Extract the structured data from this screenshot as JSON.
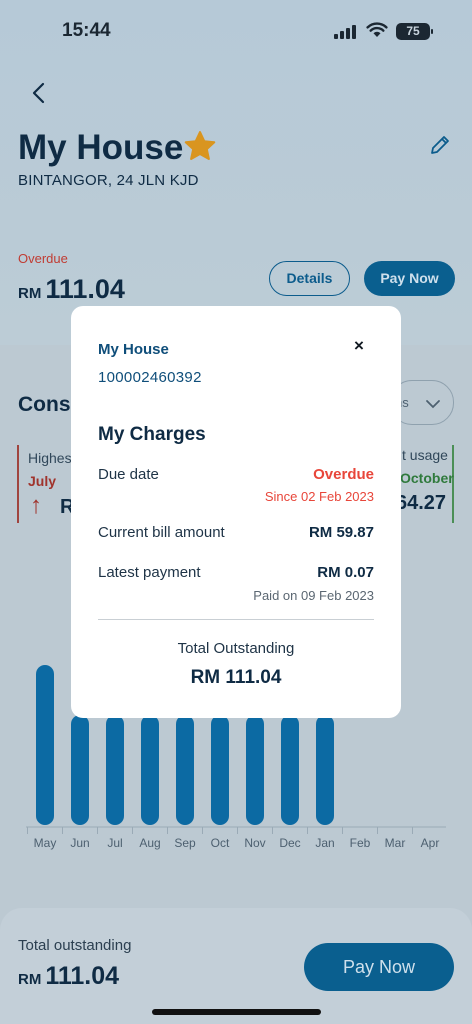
{
  "status_bar": {
    "time": "15:44",
    "battery": "75"
  },
  "header": {
    "title": "My House",
    "address": "BINTANGOR, 24 JLN KJD"
  },
  "bill": {
    "status": "Overdue",
    "currency": "RM",
    "amount": "111.04",
    "details_label": "Details",
    "pay_label": "Pay Now"
  },
  "consumption": {
    "title": "Consu",
    "period_label": "hs",
    "highest": {
      "label": "Highes",
      "month": "July",
      "value": "R"
    },
    "latest": {
      "label": "t usage",
      "month": "October",
      "value": "64.27"
    }
  },
  "chart_data": {
    "type": "bar",
    "categories": [
      "May",
      "Jun",
      "Jul",
      "Aug",
      "Sep",
      "Oct",
      "Nov",
      "Dec",
      "Jan",
      "Feb",
      "Mar",
      "Apr"
    ],
    "values": [
      150,
      null,
      null,
      null,
      null,
      null,
      null,
      null,
      null,
      null,
      null,
      null
    ],
    "bar_color": "#0c6aa3"
  },
  "bottom_bar": {
    "label": "Total outstanding",
    "currency": "RM",
    "amount": "111.04",
    "pay_label": "Pay Now"
  },
  "modal": {
    "name": "My House",
    "account_no": "100002460392",
    "close_symbol": "×",
    "heading": "My Charges",
    "due_label": "Due date",
    "due_status": "Overdue",
    "due_since": "Since 02 Feb 2023",
    "current_label": "Current bill amount",
    "current_value": "RM 59.87",
    "latest_label": "Latest payment",
    "latest_value": "RM 0.07",
    "latest_paid_on": "Paid on 09 Feb 2023",
    "total_label": "Total Outstanding",
    "total_value": "RM 111.04",
    "colors": {
      "overdue": "#e8463a",
      "heading": "#0f4e7a"
    }
  }
}
